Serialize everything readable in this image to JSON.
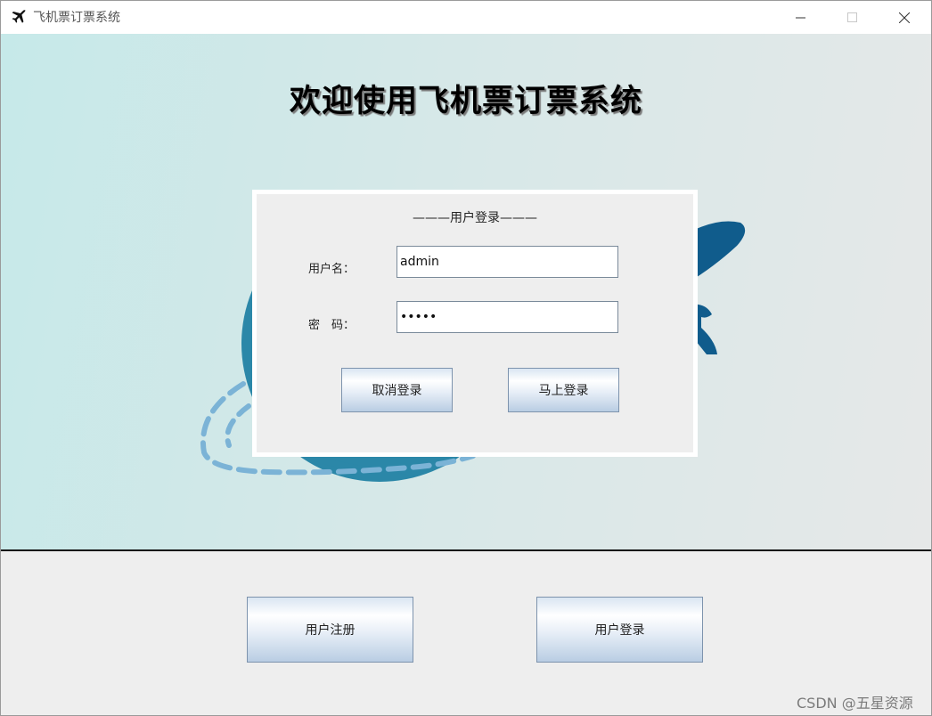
{
  "window": {
    "title": "飞机票订票系统"
  },
  "hero": {
    "title": "欢迎使用飞机票订票系统"
  },
  "login_panel": {
    "legend": "———用户登录———",
    "username_label": "用户名：",
    "password_label": "密　码：",
    "username_value": "admin",
    "password_value": "•••••",
    "cancel_button": "取消登录",
    "login_now_button": "马上登录"
  },
  "bottom": {
    "register_button": "用户注册",
    "user_login_button": "用户登录"
  },
  "watermark": "CSDN @五星资源",
  "colors": {
    "hero_gradient_start": "#c6e9e9",
    "hero_gradient_end": "#e6e8e8",
    "globe": "#2b87a8",
    "plane": "#105c8c",
    "dashed_trail": "#7bb3d6",
    "panel_background": "#eeeeee",
    "button_border": "#7d93ad"
  },
  "icons": {
    "app": "airplane-icon",
    "minimize": "minimize-icon",
    "maximize": "maximize-icon",
    "close": "close-icon"
  }
}
